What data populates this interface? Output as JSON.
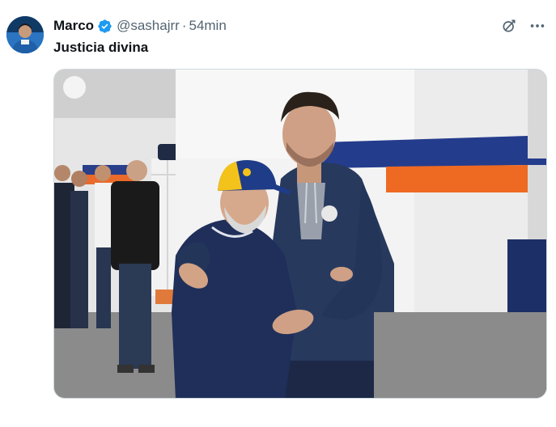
{
  "tweet": {
    "display_name": "Marco",
    "handle": "@sashajrr",
    "separator": "·",
    "time": "54min",
    "text": "Justicia divina"
  },
  "icons": {
    "verified": "verified-badge-icon",
    "grok": "grok-icon",
    "more": "more-options-icon"
  },
  "colors": {
    "verified_blue": "#1d9bf0",
    "text_primary": "#0f1419",
    "text_secondary": "#536471"
  }
}
